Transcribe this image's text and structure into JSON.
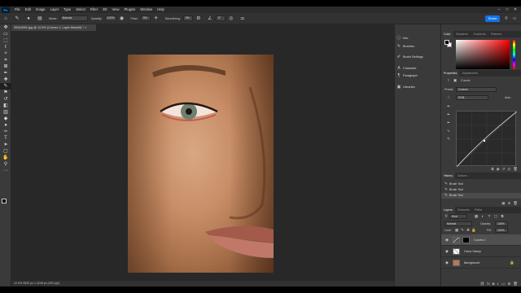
{
  "menu": {
    "logo": "Ps",
    "items": [
      "File",
      "Edit",
      "Image",
      "Layer",
      "Type",
      "Select",
      "Filter",
      "3D",
      "View",
      "Plugins",
      "Window",
      "Help"
    ]
  },
  "window_controls": {
    "minimize": "–",
    "maximize": "□",
    "close": "✕"
  },
  "options": {
    "mode_label": "Mode:",
    "mode_value": "Normal",
    "opacity_label": "Opacity:",
    "opacity_value": "100%",
    "flow_label": "Flow:",
    "flow_value": "3%",
    "smoothing_label": "Smoothing:",
    "smoothing_value": "0%",
    "angle_value": "0°",
    "share_label": "Share"
  },
  "document": {
    "tab_title": "39344992.jpg @ 12.5% (Curves 1, Layer Mask/8) *",
    "close_glyph": "×",
    "status": "12.5%    2832 px x 4248 px (300 ppi)"
  },
  "dock": {
    "items": [
      "Info",
      "Brushes",
      "Brush Settings",
      "Character",
      "Paragraph",
      "Libraries"
    ]
  },
  "color_panel": {
    "tabs": [
      "Color",
      "Swatches",
      "Gradients",
      "Patterns"
    ],
    "active_tab": 0,
    "fg_color": "#000000",
    "bg_color": "#ffffff"
  },
  "properties_panel": {
    "tabs": [
      "Properties",
      "Adjustments"
    ],
    "type_label": "Curves",
    "preset_label": "Preset:",
    "preset_value": "Custom",
    "channel_value": "RGB",
    "auto_label": "Auto"
  },
  "history_panel": {
    "tabs": [
      "History",
      "Actions"
    ],
    "items": [
      "Brush Tool",
      "Brush Tool",
      "Brush Tool"
    ],
    "selected_index": 2
  },
  "layers_panel": {
    "tabs": [
      "Layers",
      "Channels",
      "Paths"
    ],
    "kind_label": "Kind",
    "blend_value": "Normal",
    "opacity_label": "Opacity:",
    "opacity_value": "100%",
    "lock_label": "Lock:",
    "fill_label": "Fill:",
    "fill_value": "100%",
    "layers": [
      {
        "name": "Curves 1",
        "selected": true
      },
      {
        "name": "Clone Stamp",
        "selected": false
      },
      {
        "name": "Background",
        "selected": false
      }
    ]
  }
}
